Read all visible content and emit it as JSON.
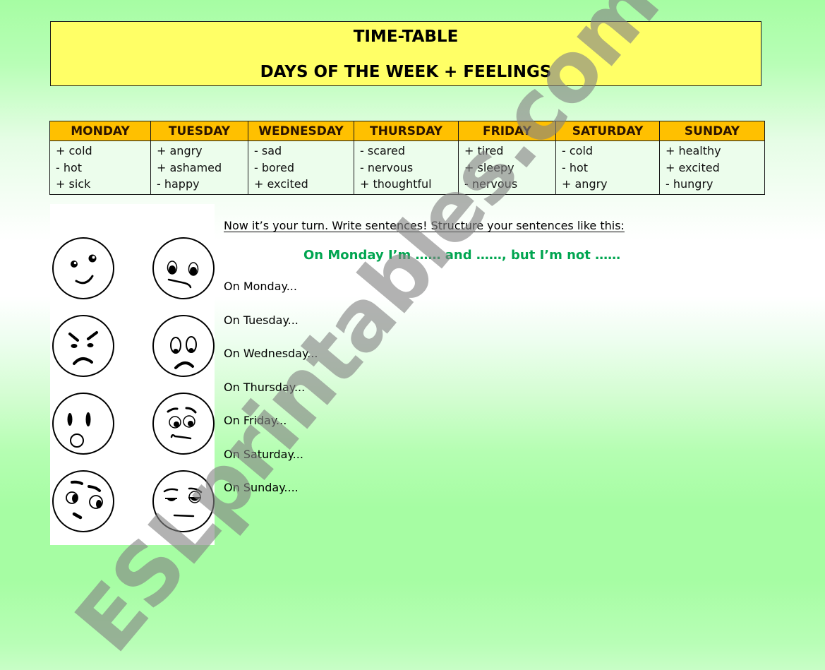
{
  "header": {
    "title": "TIME-TABLE",
    "subtitle": "DAYS OF THE WEEK + FEELINGS"
  },
  "timetable": {
    "days": [
      {
        "name": "MONDAY",
        "feelings": [
          "+ cold",
          "- hot",
          "+ sick"
        ]
      },
      {
        "name": "TUESDAY",
        "feelings": [
          "+ angry",
          "+ ashamed",
          "- happy"
        ]
      },
      {
        "name": "WEDNESDAY",
        "feelings": [
          "- sad",
          "- bored",
          "+ excited"
        ]
      },
      {
        "name": "THURSDAY",
        "feelings": [
          "- scared",
          "- nervous",
          "+ thoughtful"
        ]
      },
      {
        "name": "FRIDAY",
        "feelings": [
          "+ tired",
          "+ sleepy",
          "- nervous"
        ]
      },
      {
        "name": "SATURDAY",
        "feelings": [
          "- cold",
          "- hot",
          "+ angry"
        ]
      },
      {
        "name": "SUNDAY",
        "feelings": [
          "+ healthy",
          "+ excited",
          "- hungry"
        ]
      }
    ]
  },
  "faces": [
    {
      "expression": "happy-smile"
    },
    {
      "expression": "confused"
    },
    {
      "expression": "angry"
    },
    {
      "expression": "sad"
    },
    {
      "expression": "surprised"
    },
    {
      "expression": "worried"
    },
    {
      "expression": "doubtful"
    },
    {
      "expression": "bored-sleepy"
    }
  ],
  "exercise": {
    "instruction": "Now it’s your turn.  Write sentences! Structure your sentences like this:",
    "example": "On Monday I’m …… and ……, but I’m not ……",
    "prompts": [
      "On Monday...",
      "On Tuesday...",
      "On Wednesday...",
      "On Thursday...",
      "On Friday...",
      "On Saturday...",
      "On Sunday...."
    ]
  },
  "watermark": "ESLprintables.com",
  "colors": {
    "title_bg": "#ffff66",
    "header_bg": "#ffc000",
    "example_text": "#00a550",
    "page_green": "#a6fda3"
  }
}
